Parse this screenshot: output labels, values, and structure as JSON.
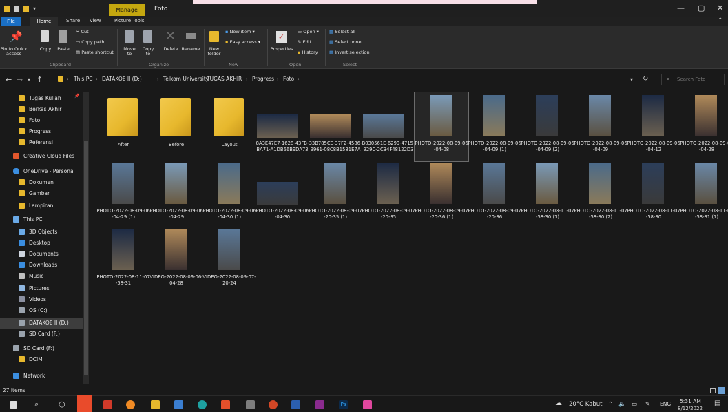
{
  "window": {
    "title": "Foto",
    "manage_tab": "Manage"
  },
  "ribbon_tabs": [
    "File",
    "Home",
    "Share",
    "View",
    "Picture Tools"
  ],
  "ribbon": {
    "pin": "Pin to Quick access",
    "copy": "Copy",
    "paste": "Paste",
    "cut": "Cut",
    "copy_path": "Copy path",
    "paste_shortcut": "Paste shortcut",
    "move_to": "Move to",
    "copy_to": "Copy to",
    "delete": "Delete",
    "rename": "Rename",
    "new_folder": "New folder",
    "new_item": "New item",
    "easy_access": "Easy access",
    "properties": "Properties",
    "open": "Open",
    "edit": "Edit",
    "history": "History",
    "select_all": "Select all",
    "select_none": "Select none",
    "invert_selection": "Invert selection",
    "groups": {
      "clipboard": "Clipboard",
      "organize": "Organize",
      "new": "New",
      "open": "Open",
      "select": "Select"
    }
  },
  "breadcrumb": [
    "This PC",
    "DATAKOE II (D:)",
    "Telkom University",
    "TUGAS AKHIR",
    "Progress",
    "Foto"
  ],
  "search": {
    "placeholder": "Search Foto"
  },
  "sidebar": [
    {
      "label": "Tugas Kuliah",
      "icon": "folder-icon"
    },
    {
      "label": "Berkas Akhir",
      "icon": "folder-icon"
    },
    {
      "label": "Foto",
      "icon": "folder-icon"
    },
    {
      "label": "Progress",
      "icon": "folder-icon"
    },
    {
      "label": "Referensi",
      "icon": "folder-icon"
    },
    {
      "label": "Creative Cloud Files",
      "icon": "creative-cloud-icon"
    },
    {
      "label": "OneDrive - Personal",
      "icon": "cloud-icon"
    },
    {
      "label": "Dokumen",
      "icon": "folder-icon"
    },
    {
      "label": "Gambar",
      "icon": "folder-icon"
    },
    {
      "label": "Lampiran",
      "icon": "folder-icon"
    },
    {
      "label": "This PC",
      "icon": "pc-icon"
    },
    {
      "label": "3D Objects",
      "icon": "cube-icon"
    },
    {
      "label": "Desktop",
      "icon": "desktop-icon"
    },
    {
      "label": "Documents",
      "icon": "documents-icon"
    },
    {
      "label": "Downloads",
      "icon": "download-icon"
    },
    {
      "label": "Music",
      "icon": "music-icon"
    },
    {
      "label": "Pictures",
      "icon": "pictures-icon"
    },
    {
      "label": "Videos",
      "icon": "videos-icon"
    },
    {
      "label": "OS (C:)",
      "icon": "drive-icon"
    },
    {
      "label": "DATAKOE II (D:)",
      "icon": "drive-icon"
    },
    {
      "label": "SD Card (F:)",
      "icon": "sd-card-icon"
    },
    {
      "label": "SD Card (F:)",
      "icon": "sd-card-icon"
    },
    {
      "label": "DCIM",
      "icon": "folder-icon"
    },
    {
      "label": "Network",
      "icon": "network-icon"
    }
  ],
  "files": [
    {
      "name": "After",
      "kind": "folder"
    },
    {
      "name": "Before",
      "kind": "folder"
    },
    {
      "name": "Layout",
      "kind": "folder"
    },
    {
      "name": "8A3E47E7-1628-43FB-BA71-A1DB66B9DA73",
      "kind": "wide"
    },
    {
      "name": "33B785CE-37F2-4586-9961-08C8B1581E7A",
      "kind": "wide"
    },
    {
      "name": "B030561E-6299-4715-929C-2C34F48122D3",
      "kind": "wide"
    },
    {
      "name": "PHOTO-2022-08-09-06-04-08",
      "kind": "tall"
    },
    {
      "name": "PHOTO-2022-08-09-06-04-09 (1)",
      "kind": "tall"
    },
    {
      "name": "PHOTO-2022-08-09-06-04-09 (2)",
      "kind": "tall"
    },
    {
      "name": "PHOTO-2022-08-09-06-04-09",
      "kind": "tall"
    },
    {
      "name": "PHOTO-2022-08-09-06-04-12",
      "kind": "tall"
    },
    {
      "name": "PHOTO-2022-08-09-06-04-28",
      "kind": "tall"
    },
    {
      "name": "PHOTO-2022-08-09-06-04-29 (1)",
      "kind": "tall"
    },
    {
      "name": "PHOTO-2022-08-09-06-04-29",
      "kind": "tall"
    },
    {
      "name": "PHOTO-2022-08-09-06-04-30 (1)",
      "kind": "tall"
    },
    {
      "name": "PHOTO-2022-08-09-06-04-30",
      "kind": "wide"
    },
    {
      "name": "PHOTO-2022-08-09-07-20-35 (1)",
      "kind": "tall"
    },
    {
      "name": "PHOTO-2022-08-09-07-20-35",
      "kind": "tall"
    },
    {
      "name": "PHOTO-2022-08-09-07-20-36 (1)",
      "kind": "tall"
    },
    {
      "name": "PHOTO-2022-08-09-07-20-36",
      "kind": "tall"
    },
    {
      "name": "PHOTO-2022-08-11-07-58-30 (1)",
      "kind": "tall"
    },
    {
      "name": "PHOTO-2022-08-11-07-58-30 (2)",
      "kind": "tall"
    },
    {
      "name": "PHOTO-2022-08-11-07-58-30",
      "kind": "tall"
    },
    {
      "name": "PHOTO-2022-08-11-07-58-31 (1)",
      "kind": "tall"
    },
    {
      "name": "PHOTO-2022-08-11-07-58-31",
      "kind": "tall"
    },
    {
      "name": "VIDEO-2022-08-09-06-04-28",
      "kind": "tall"
    },
    {
      "name": "VIDEO-2022-08-09-07-20-24",
      "kind": "tall"
    }
  ],
  "status": {
    "items": "27 items"
  },
  "taskbar": {
    "weather": "20°C Kabut",
    "lang": "ENG",
    "time": "5:31 AM",
    "date": "8/12/2022"
  }
}
